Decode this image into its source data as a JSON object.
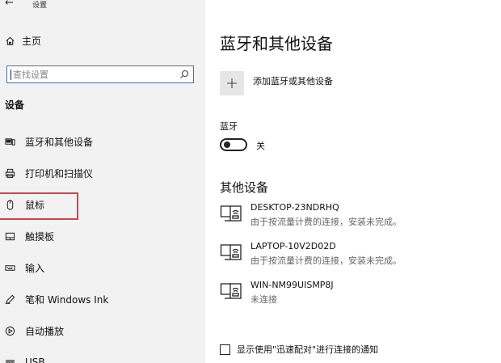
{
  "window": {
    "back_glyph": "←",
    "title": "设置"
  },
  "sidebar": {
    "home_label": "主页",
    "search_placeholder": "查找设置",
    "section_label": "设备",
    "items": [
      {
        "label": "蓝牙和其他设备",
        "icon": "bluetooth-devices-icon"
      },
      {
        "label": "打印机和扫描仪",
        "icon": "printer-icon"
      },
      {
        "label": "鼠标",
        "icon": "mouse-icon"
      },
      {
        "label": "触摸板",
        "icon": "touchpad-icon"
      },
      {
        "label": "输入",
        "icon": "keyboard-icon"
      },
      {
        "label": "笔和 Windows Ink",
        "icon": "pen-icon"
      },
      {
        "label": "自动播放",
        "icon": "autoplay-icon"
      },
      {
        "label": "USB",
        "icon": "usb-icon"
      }
    ]
  },
  "main": {
    "title": "蓝牙和其他设备",
    "add_device_label": "添加蓝牙或其他设备",
    "bluetooth_label": "蓝牙",
    "bluetooth_state": "关",
    "other_devices_title": "其他设备",
    "devices": [
      {
        "name": "DESKTOP-23NDRHQ",
        "status": "由于按流量计费的连接，安装未完成。"
      },
      {
        "name": "LAPTOP-10V2D02D",
        "status": "由于按流量计费的连接，安装未完成。"
      },
      {
        "name": "WIN-NM99UISMP8J",
        "status": "未连接"
      }
    ],
    "swift_pair_label": "显示使用\"迅速配对\"进行连接的通知"
  },
  "colors": {
    "sidebar_bg": "#f2f2f2",
    "highlight": "#e8393f",
    "search_border": "#4f6fa8"
  }
}
